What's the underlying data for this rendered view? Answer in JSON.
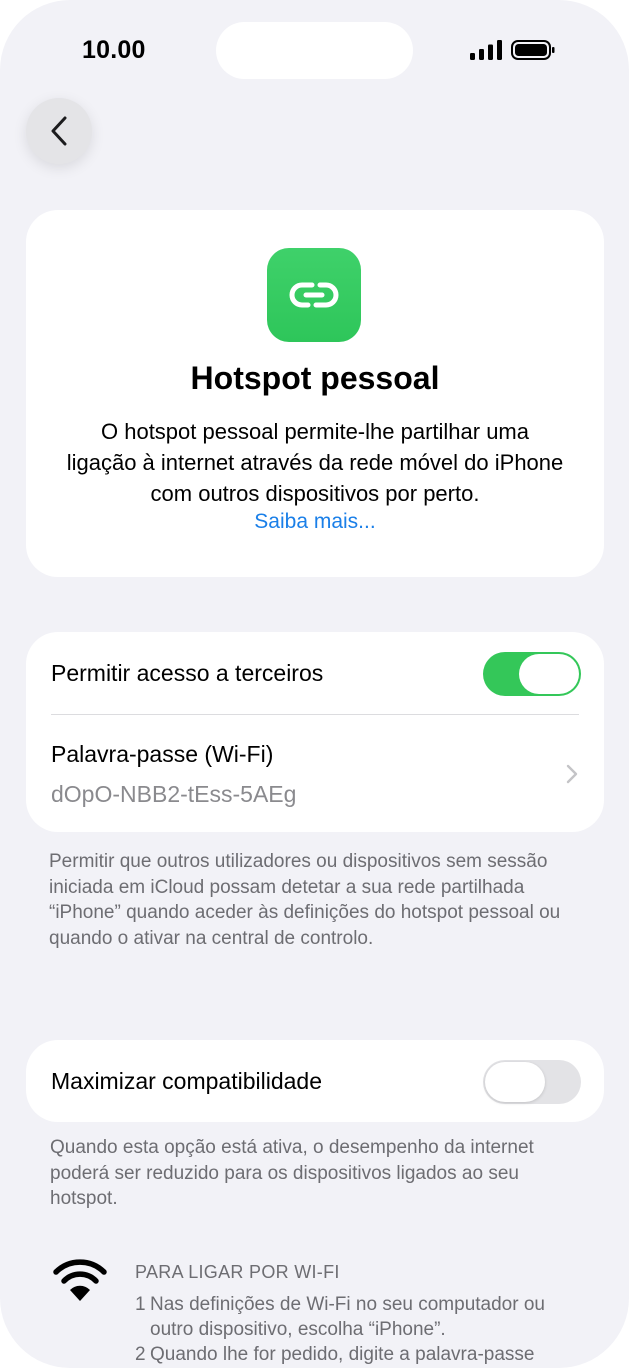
{
  "status_bar": {
    "time": "10.00"
  },
  "hero": {
    "title": "Hotspot pessoal",
    "description": "O hotspot pessoal permite-lhe partilhar uma ligação à internet através da rede móvel do iPhone com outros dispositivos por perto.",
    "link": "Saiba mais..."
  },
  "access": {
    "allow_label": "Permitir acesso a terceiros",
    "allow_enabled": true,
    "password_label": "Palavra-passe (Wi-Fi)",
    "password_value": "dOpO-NBB2-tEss-5AEg",
    "footnote": "Permitir que outros utilizadores ou dispositivos sem sessão iniciada em iCloud possam detetar a sua rede partilhada “iPhone” quando aceder às definições do hotspot pessoal ou quando o ativar na central de controlo."
  },
  "compat": {
    "label": "Maximizar compatibilidade",
    "enabled": false,
    "footnote": "Quando esta opção está ativa, o desempenho da internet poderá ser reduzido para os dispositivos ligados ao seu hotspot."
  },
  "wifi_instructions": {
    "heading": "PARA LIGAR POR WI-FI",
    "steps": [
      {
        "num": "1",
        "text": "Nas definições de Wi-Fi no seu computador ou",
        "text2": "outro dispositivo, escolha “iPhone”."
      },
      {
        "num": "2",
        "text": "Quando lhe for pedido, digite a palavra-passe"
      }
    ]
  },
  "colors": {
    "accent": "#34c759",
    "link": "#1a7fe8",
    "background": "#f2f2f7"
  }
}
